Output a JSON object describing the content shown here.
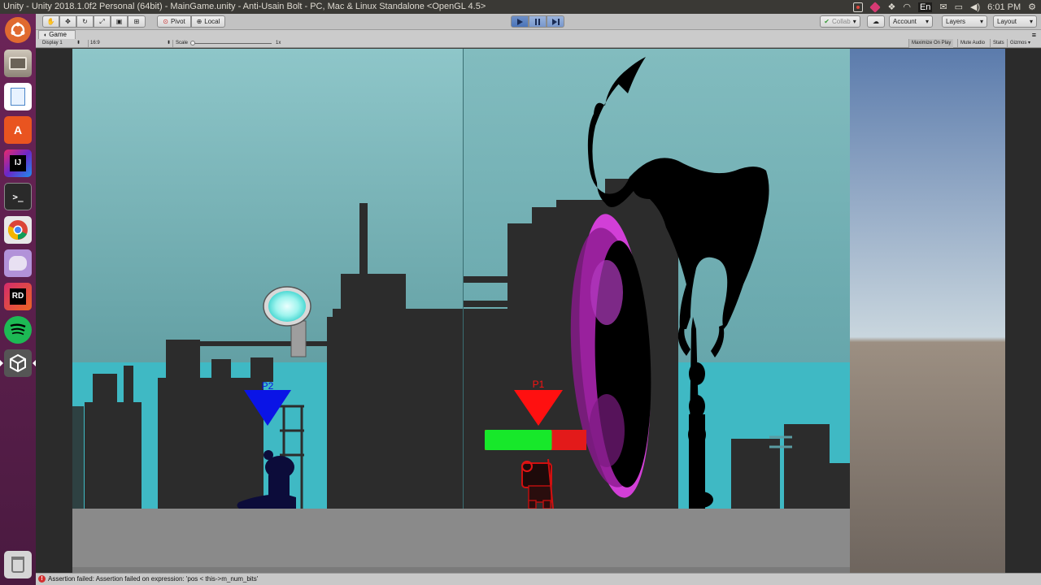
{
  "window": {
    "title": "Unity - Unity 2018.1.0f2 Personal (64bit) - MainGame.unity - Anti-Usain Bolt - PC, Mac & Linux Standalone <OpenGL 4.5>",
    "clock": "6:01 PM",
    "lang": "En"
  },
  "toolbar": {
    "pivot": "Pivot",
    "local": "Local",
    "collab": "Collab",
    "account": "Account",
    "layers": "Layers",
    "layout": "Layout"
  },
  "game_view": {
    "tab_label": "Game",
    "display": "Display 1",
    "aspect": "16:9",
    "scale_label": "Scale",
    "scale_value": "1x",
    "maximize_on_play": "Maximize On Play",
    "mute_audio": "Mute Audio",
    "stats": "Stats",
    "gizmos": "Gizmos"
  },
  "scene": {
    "p1_label": "P1",
    "p2_label": "P2",
    "p1_health": 0.66,
    "colors": {
      "sky": "#7fbcc0",
      "water": "#3fb9c4",
      "silhouette": "#2c2c2c",
      "ground": "#8a8a8a",
      "p1": "#ff1010",
      "p2": "#0a14e6",
      "health_good": "#17e82a",
      "health_bad": "#e31a1a",
      "portal": "#d23fd7"
    }
  },
  "console": {
    "message": "Assertion failed: Assertion failed on expression: 'pos < this->m_num_bits'"
  },
  "launcher": {
    "apps": [
      "ubuntu-dash-icon",
      "files-icon",
      "document-viewer-icon",
      "software-center-icon",
      "intellij-icon",
      "terminal-icon",
      "chrome-icon",
      "pidgin-icon",
      "rider-icon",
      "spotify-icon",
      "unity-icon",
      "trash-icon"
    ]
  }
}
